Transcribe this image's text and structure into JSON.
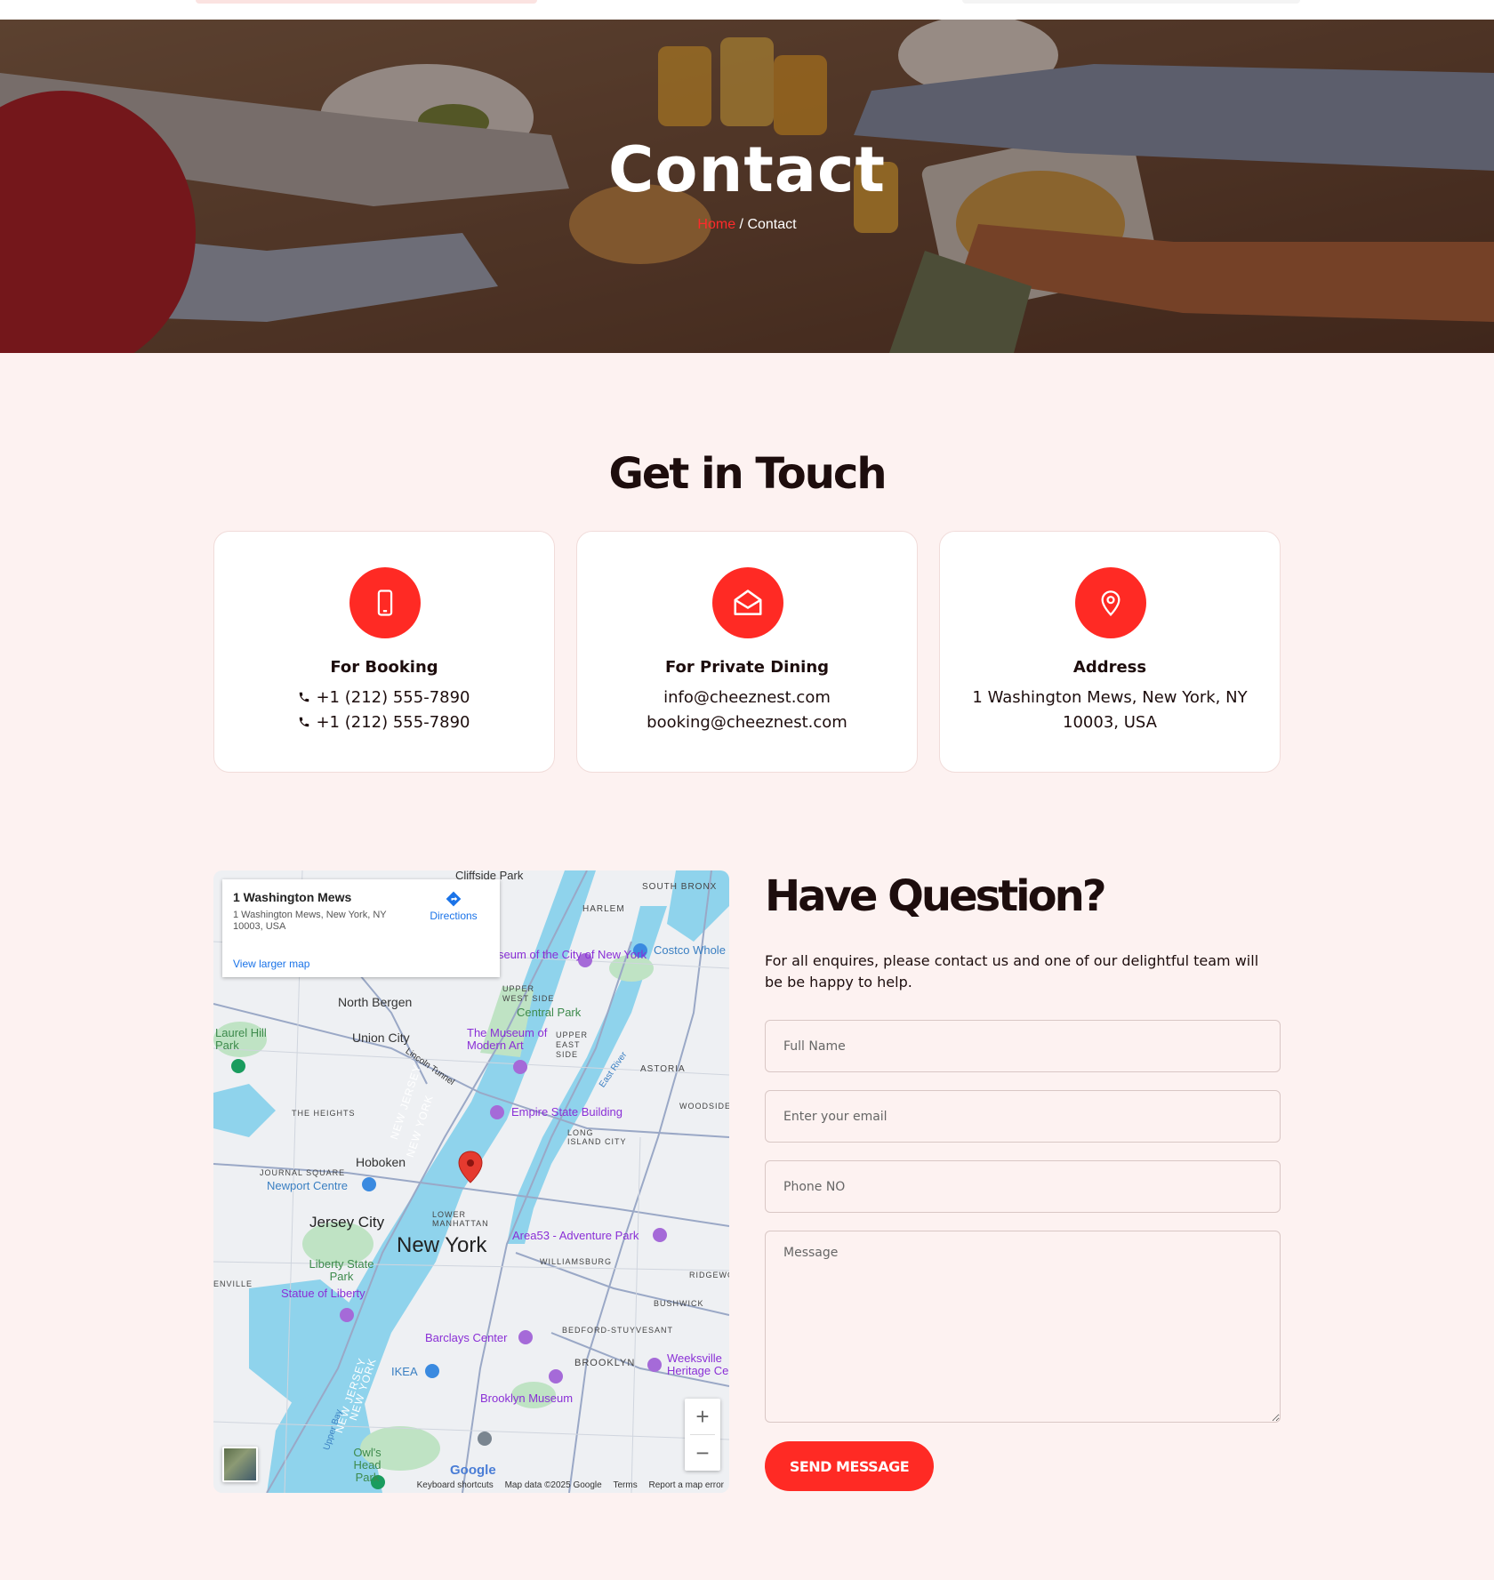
{
  "hero": {
    "title": "Contact",
    "breadcrumb": {
      "home": "Home",
      "separator": " / ",
      "current": "Contact"
    }
  },
  "touch": {
    "title": "Get in Touch",
    "cards": [
      {
        "icon": "mobile-phone-icon",
        "title": "For Booking",
        "lines": [
          "+1 (212) 555-7890",
          "+1 (212) 555-7890"
        ]
      },
      {
        "icon": "envelope-icon",
        "title": "For Private Dining",
        "lines": [
          "info@cheeznest.com",
          "booking@cheeznest.com"
        ]
      },
      {
        "icon": "map-pin-icon",
        "title": "Address",
        "lines": [
          "1 Washington Mews, New York, NY",
          "10003, USA"
        ]
      }
    ]
  },
  "map": {
    "place_title": "1 Washington Mews",
    "place_address": "1 Washington Mews, New York, NY 10003, USA",
    "directions": "Directions",
    "view_larger": "View larger map",
    "labels": {
      "cliffside": "Cliffside Park",
      "south_bronx": "SOUTH BRONX",
      "harlem": "HARLEM",
      "museum_cny": "Museum of the City of New York",
      "costco": "Costco Whole",
      "upper_west": "UPPER WEST SIDE",
      "central_park": "Central Park",
      "north_bergen": "North Bergen",
      "union_city": "Union City",
      "laurel": "Laurel Hill Park",
      "moma": "The Museum of Modern Art",
      "upper_east": "UPPER EAST SIDE",
      "astoria": "ASTORIA",
      "the_heights": "THE HEIGHTS",
      "empire": "Empire State Building",
      "woodside": "WOODSIDE",
      "lic": "LONG ISLAND CITY",
      "hoboken": "Hoboken",
      "journal_sq": "JOURNAL SQUARE",
      "newport": "Newport Centre",
      "lower_manhattan": "LOWER MANHATTAN",
      "jersey_city": "Jersey City",
      "new_york": "New York",
      "area53": "Area53 - Adventure Park",
      "williamsburg": "WILLIAMSBURG",
      "liberty_park": "Liberty State Park",
      "statue": "Statue of Liberty",
      "ridgewood": "RIDGEWO",
      "bushwick": "BUSHWICK",
      "barclays": "Barclays Center",
      "bed_stuy": "BEDFORD-STUYVESANT",
      "brooklyn": "BROOKLYN",
      "weeksville": "Weeksville Heritage Ce",
      "ikea": "IKEA",
      "brooklyn_museum": "Brooklyn Museum",
      "owls_head": "Owl's Head Park",
      "enville": "ENVILLE",
      "nj_river": "NEW JERSEY",
      "ny_river": "NEW YORK",
      "east_river": "East River",
      "lincoln_tunnel": "Lincoln Tunnel",
      "upper_bay": "Upper Bay"
    },
    "zoom_in": "+",
    "zoom_out": "−",
    "google": "Google",
    "attribution": [
      "Keyboard shortcuts",
      "Map data ©2025 Google",
      "Terms",
      "Report a map error"
    ]
  },
  "form": {
    "title": "Have Question?",
    "description": "For all enquires, please contact us and one of our delightful team will be be happy to help.",
    "full_name_placeholder": "Full Name",
    "email_placeholder": "Enter your email",
    "phone_placeholder": "Phone NO",
    "message_placeholder": "Message",
    "submit": "SEND MESSAGE"
  },
  "colors": {
    "accent": "#ff2a24",
    "background": "#fdf2f1",
    "text": "#1d0d0d"
  }
}
